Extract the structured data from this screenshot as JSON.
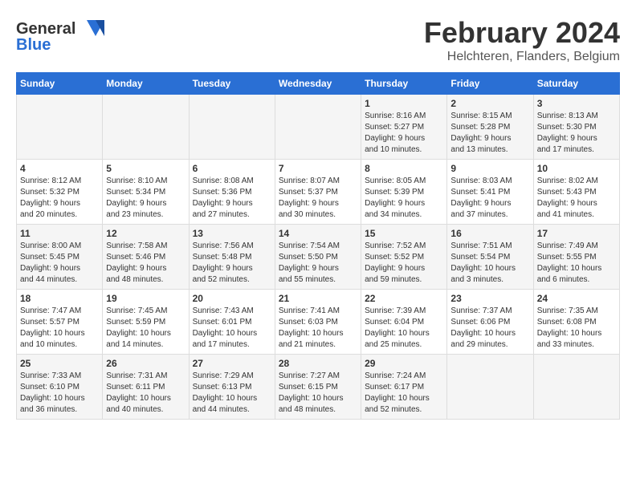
{
  "logo": {
    "general": "General",
    "blue": "Blue"
  },
  "title": "February 2024",
  "subtitle": "Helchteren, Flanders, Belgium",
  "days_of_week": [
    "Sunday",
    "Monday",
    "Tuesday",
    "Wednesday",
    "Thursday",
    "Friday",
    "Saturday"
  ],
  "weeks": [
    [
      {
        "day": "",
        "info": ""
      },
      {
        "day": "",
        "info": ""
      },
      {
        "day": "",
        "info": ""
      },
      {
        "day": "",
        "info": ""
      },
      {
        "day": "1",
        "info": "Sunrise: 8:16 AM\nSunset: 5:27 PM\nDaylight: 9 hours\nand 10 minutes."
      },
      {
        "day": "2",
        "info": "Sunrise: 8:15 AM\nSunset: 5:28 PM\nDaylight: 9 hours\nand 13 minutes."
      },
      {
        "day": "3",
        "info": "Sunrise: 8:13 AM\nSunset: 5:30 PM\nDaylight: 9 hours\nand 17 minutes."
      }
    ],
    [
      {
        "day": "4",
        "info": "Sunrise: 8:12 AM\nSunset: 5:32 PM\nDaylight: 9 hours\nand 20 minutes."
      },
      {
        "day": "5",
        "info": "Sunrise: 8:10 AM\nSunset: 5:34 PM\nDaylight: 9 hours\nand 23 minutes."
      },
      {
        "day": "6",
        "info": "Sunrise: 8:08 AM\nSunset: 5:36 PM\nDaylight: 9 hours\nand 27 minutes."
      },
      {
        "day": "7",
        "info": "Sunrise: 8:07 AM\nSunset: 5:37 PM\nDaylight: 9 hours\nand 30 minutes."
      },
      {
        "day": "8",
        "info": "Sunrise: 8:05 AM\nSunset: 5:39 PM\nDaylight: 9 hours\nand 34 minutes."
      },
      {
        "day": "9",
        "info": "Sunrise: 8:03 AM\nSunset: 5:41 PM\nDaylight: 9 hours\nand 37 minutes."
      },
      {
        "day": "10",
        "info": "Sunrise: 8:02 AM\nSunset: 5:43 PM\nDaylight: 9 hours\nand 41 minutes."
      }
    ],
    [
      {
        "day": "11",
        "info": "Sunrise: 8:00 AM\nSunset: 5:45 PM\nDaylight: 9 hours\nand 44 minutes."
      },
      {
        "day": "12",
        "info": "Sunrise: 7:58 AM\nSunset: 5:46 PM\nDaylight: 9 hours\nand 48 minutes."
      },
      {
        "day": "13",
        "info": "Sunrise: 7:56 AM\nSunset: 5:48 PM\nDaylight: 9 hours\nand 52 minutes."
      },
      {
        "day": "14",
        "info": "Sunrise: 7:54 AM\nSunset: 5:50 PM\nDaylight: 9 hours\nand 55 minutes."
      },
      {
        "day": "15",
        "info": "Sunrise: 7:52 AM\nSunset: 5:52 PM\nDaylight: 9 hours\nand 59 minutes."
      },
      {
        "day": "16",
        "info": "Sunrise: 7:51 AM\nSunset: 5:54 PM\nDaylight: 10 hours\nand 3 minutes."
      },
      {
        "day": "17",
        "info": "Sunrise: 7:49 AM\nSunset: 5:55 PM\nDaylight: 10 hours\nand 6 minutes."
      }
    ],
    [
      {
        "day": "18",
        "info": "Sunrise: 7:47 AM\nSunset: 5:57 PM\nDaylight: 10 hours\nand 10 minutes."
      },
      {
        "day": "19",
        "info": "Sunrise: 7:45 AM\nSunset: 5:59 PM\nDaylight: 10 hours\nand 14 minutes."
      },
      {
        "day": "20",
        "info": "Sunrise: 7:43 AM\nSunset: 6:01 PM\nDaylight: 10 hours\nand 17 minutes."
      },
      {
        "day": "21",
        "info": "Sunrise: 7:41 AM\nSunset: 6:03 PM\nDaylight: 10 hours\nand 21 minutes."
      },
      {
        "day": "22",
        "info": "Sunrise: 7:39 AM\nSunset: 6:04 PM\nDaylight: 10 hours\nand 25 minutes."
      },
      {
        "day": "23",
        "info": "Sunrise: 7:37 AM\nSunset: 6:06 PM\nDaylight: 10 hours\nand 29 minutes."
      },
      {
        "day": "24",
        "info": "Sunrise: 7:35 AM\nSunset: 6:08 PM\nDaylight: 10 hours\nand 33 minutes."
      }
    ],
    [
      {
        "day": "25",
        "info": "Sunrise: 7:33 AM\nSunset: 6:10 PM\nDaylight: 10 hours\nand 36 minutes."
      },
      {
        "day": "26",
        "info": "Sunrise: 7:31 AM\nSunset: 6:11 PM\nDaylight: 10 hours\nand 40 minutes."
      },
      {
        "day": "27",
        "info": "Sunrise: 7:29 AM\nSunset: 6:13 PM\nDaylight: 10 hours\nand 44 minutes."
      },
      {
        "day": "28",
        "info": "Sunrise: 7:27 AM\nSunset: 6:15 PM\nDaylight: 10 hours\nand 48 minutes."
      },
      {
        "day": "29",
        "info": "Sunrise: 7:24 AM\nSunset: 6:17 PM\nDaylight: 10 hours\nand 52 minutes."
      },
      {
        "day": "",
        "info": ""
      },
      {
        "day": "",
        "info": ""
      }
    ]
  ]
}
